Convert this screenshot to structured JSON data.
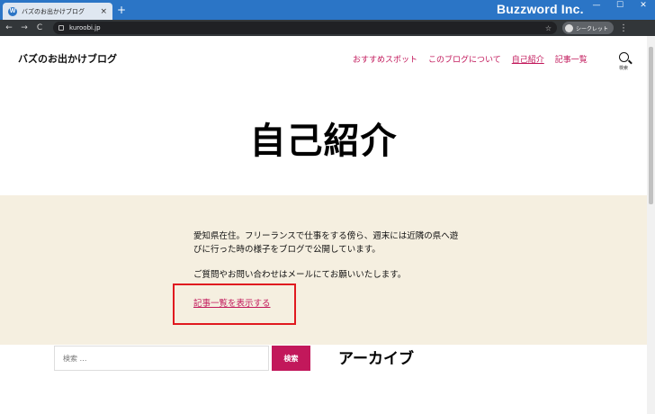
{
  "browser": {
    "tab_title": "バズのお出かけブログ",
    "tab_close": "×",
    "new_tab": "+",
    "brand": "Buzzword Inc.",
    "win_min": "—",
    "win_max": "☐",
    "win_close": "✕",
    "back": "←",
    "forward": "→",
    "reload": "C",
    "url": "kuroobi.jp",
    "star": "☆",
    "incognito_label": "シークレット",
    "menu": "⋮"
  },
  "header": {
    "site_title": "バズのお出かけブログ",
    "nav": [
      {
        "label": "おすすめスポット"
      },
      {
        "label": "このブログについて"
      },
      {
        "label": "自己紹介"
      },
      {
        "label": "記事一覧"
      }
    ],
    "search_label": "検索"
  },
  "main": {
    "page_title": "自己紹介",
    "intro_p1": "愛知県在住。フリーランスで仕事をする傍ら、週末には近隣の県へ遊びに行った時の様子をブログで公開しています。",
    "intro_p2": "ご質問やお問い合わせはメールにてお願いいたします。",
    "intro_link": "記事一覧を表示する"
  },
  "footer": {
    "search_placeholder": "検索 …",
    "search_button": "検索",
    "archive_title": "アーカイブ"
  },
  "colors": {
    "accent": "#c2185b",
    "intro_bg": "#f5efe0",
    "highlight": "#e0191f",
    "titlebar": "#2b75c6"
  }
}
